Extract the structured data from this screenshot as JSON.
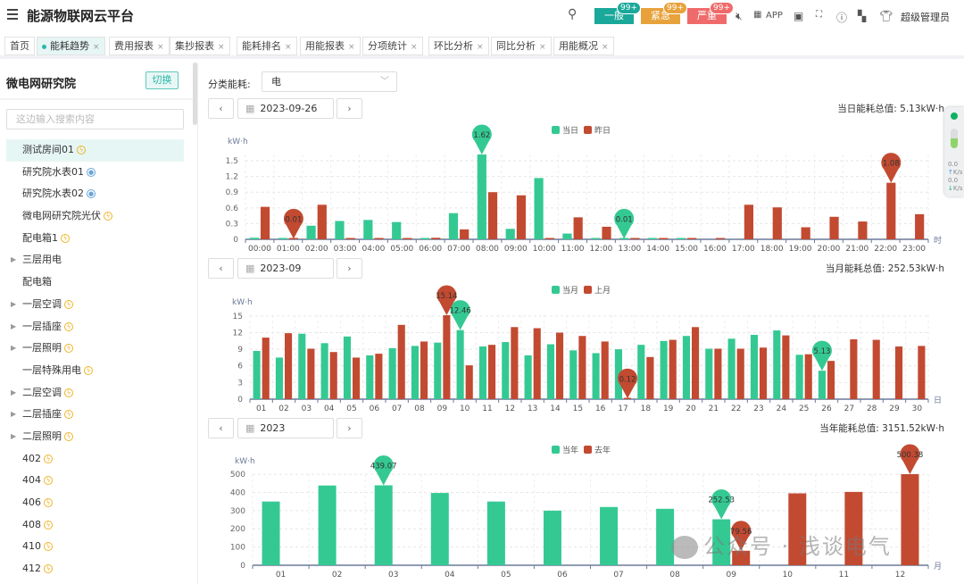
{
  "header": {
    "title": "能源物联网云平台",
    "alarms": [
      {
        "label": "一般",
        "count": "99+",
        "color": "#1aa89a"
      },
      {
        "label": "紧急",
        "count": "99+",
        "color": "#e8a23b"
      },
      {
        "label": "严重",
        "count": "99+",
        "color": "#ef6b6b"
      }
    ],
    "app_label": "APP",
    "user": "超级管理员"
  },
  "tabs": [
    {
      "label": "首页"
    },
    {
      "label": "能耗趋势",
      "active": true
    },
    {
      "label": "费用报表"
    },
    {
      "label": "集抄报表"
    },
    {
      "label": "能耗排名"
    },
    {
      "label": "用能报表"
    },
    {
      "label": "分项统计"
    },
    {
      "label": "环比分析"
    },
    {
      "label": "同比分析"
    },
    {
      "label": "用能概况"
    }
  ],
  "sidebar": {
    "title": "微电网研究院",
    "switch_label": "切换",
    "search_placeholder": "这边输入搜索内容",
    "items": [
      {
        "label": "测试房间01",
        "icon": "bolt",
        "selected": true
      },
      {
        "label": "研究院水表01",
        "icon": "drop"
      },
      {
        "label": "研究院水表02",
        "icon": "drop"
      },
      {
        "label": "微电网研究院光伏",
        "icon": "bolt"
      },
      {
        "label": "配电箱1",
        "icon": "bolt"
      },
      {
        "label": "三层用电",
        "expand": true
      },
      {
        "label": "配电箱"
      },
      {
        "label": "一层空调",
        "icon": "bolt",
        "expand": true
      },
      {
        "label": "一层插座",
        "icon": "bolt",
        "expand": true
      },
      {
        "label": "一层照明",
        "icon": "bolt",
        "expand": true
      },
      {
        "label": "一层特殊用电",
        "icon": "bolt"
      },
      {
        "label": "二层空调",
        "icon": "bolt",
        "expand": true
      },
      {
        "label": "二层插座",
        "icon": "bolt",
        "expand": true
      },
      {
        "label": "二层照明",
        "icon": "bolt",
        "expand": true
      },
      {
        "label": "402",
        "icon": "bolt"
      },
      {
        "label": "404",
        "icon": "bolt"
      },
      {
        "label": "406",
        "icon": "bolt"
      },
      {
        "label": "408",
        "icon": "bolt"
      },
      {
        "label": "410",
        "icon": "bolt"
      },
      {
        "label": "412",
        "icon": "bolt"
      }
    ]
  },
  "filter": {
    "label": "分类能耗:",
    "value": "电"
  },
  "panels": [
    {
      "date": "2023-09-26",
      "total": "当日能耗总值: 5.13kW·h"
    },
    {
      "date": "2023-09",
      "total": "当月能耗总值: 252.53kW·h"
    },
    {
      "date": "2023",
      "total": "当年能耗总值: 3151.52kW·h"
    }
  ],
  "float_panel": {
    "up": "0.0",
    "up_unit": "K/s",
    "down": "0.0",
    "down_unit": "K/s"
  },
  "watermark": "公众号 · 浅谈电气",
  "colors": {
    "current": "#34c993",
    "previous": "#c24a31"
  },
  "chart_data": [
    {
      "type": "bar",
      "ylabel": "kW·h",
      "xunit": "时",
      "ylim": [
        0,
        1.62
      ],
      "yticks": [
        0,
        0.3,
        0.6,
        0.9,
        1.2,
        1.5
      ],
      "categories": [
        "00:00",
        "01:00",
        "02:00",
        "03:00",
        "04:00",
        "05:00",
        "06:00",
        "07:00",
        "08:00",
        "09:00",
        "10:00",
        "11:00",
        "12:00",
        "13:00",
        "14:00",
        "15:00",
        "16:00",
        "17:00",
        "18:00",
        "19:00",
        "20:00",
        "21:00",
        "22:00",
        "23:00"
      ],
      "series": [
        {
          "name": "当日",
          "values": [
            0.03,
            0.01,
            0.26,
            0.35,
            0.37,
            0.33,
            0.01,
            0.5,
            1.62,
            0.2,
            1.17,
            0.11,
            0.01,
            0.01,
            0.01,
            0.01,
            0,
            0,
            0,
            0,
            0,
            0,
            0,
            0
          ],
          "markers": [
            {
              "index": 8,
              "label": "1.62"
            },
            {
              "index": 13,
              "label": "0.01"
            }
          ]
        },
        {
          "name": "昨日",
          "values": [
            0.62,
            0.01,
            0.66,
            0.02,
            0.01,
            0.01,
            0.03,
            0.19,
            0.9,
            0.84,
            0.01,
            0.42,
            0.24,
            0.01,
            0.01,
            0.01,
            0.01,
            0.66,
            0.61,
            0.23,
            0.43,
            0.34,
            1.08,
            0.48
          ],
          "markers": [
            {
              "index": 1,
              "label": "0.01"
            },
            {
              "index": 22,
              "label": "1.08"
            }
          ]
        }
      ]
    },
    {
      "type": "bar",
      "ylabel": "kW·h",
      "xunit": "日",
      "ylim": [
        0,
        15.14
      ],
      "yticks": [
        0,
        3,
        6,
        9,
        12,
        15
      ],
      "categories": [
        "01",
        "02",
        "03",
        "04",
        "05",
        "06",
        "07",
        "08",
        "09",
        "10",
        "11",
        "12",
        "13",
        "14",
        "15",
        "16",
        "17",
        "18",
        "19",
        "20",
        "21",
        "22",
        "23",
        "24",
        "25",
        "26",
        "27",
        "28",
        "29",
        "30"
      ],
      "series": [
        {
          "name": "当月",
          "values": [
            8.7,
            7.5,
            11.8,
            10.1,
            11.3,
            7.9,
            9.2,
            9.6,
            10.2,
            12.46,
            9.5,
            10.3,
            7.9,
            9.9,
            8.8,
            8.3,
            9.0,
            9.8,
            10.5,
            11.4,
            9.1,
            10.9,
            11.6,
            12.4,
            8.0,
            5.13,
            null,
            null,
            null,
            null
          ],
          "markers": [
            {
              "index": 9,
              "label": "12.46"
            },
            {
              "index": 25,
              "label": "5.13"
            }
          ]
        },
        {
          "name": "上月",
          "values": [
            11.1,
            11.9,
            9.1,
            8.5,
            7.5,
            8.2,
            13.4,
            10.4,
            15.14,
            6.1,
            9.8,
            13.0,
            12.8,
            12.0,
            11.4,
            10.4,
            0.12,
            7.6,
            10.7,
            13.0,
            9.1,
            9.1,
            9.3,
            11.5,
            8.1,
            6.9,
            10.8,
            10.7,
            9.5,
            9.6
          ],
          "markers": [
            {
              "index": 8,
              "label": "15.14"
            },
            {
              "index": 16,
              "label": "0.12"
            }
          ]
        }
      ]
    },
    {
      "type": "bar",
      "ylabel": "kW·h",
      "xunit": "月",
      "ylim": [
        0,
        500.38
      ],
      "yticks": [
        0,
        100,
        200,
        300,
        400,
        500
      ],
      "categories": [
        "01",
        "02",
        "03",
        "04",
        "05",
        "06",
        "07",
        "08",
        "09",
        "10",
        "11",
        "12"
      ],
      "series": [
        {
          "name": "当年",
          "values": [
            350,
            438,
            439.07,
            397,
            350,
            300,
            320,
            310,
            252.53,
            null,
            null,
            null
          ],
          "markers": [
            {
              "index": 2,
              "label": "439.07"
            },
            {
              "index": 8,
              "label": "252.53"
            }
          ]
        },
        {
          "name": "去年",
          "values": [
            null,
            null,
            null,
            null,
            null,
            null,
            null,
            null,
            79.56,
            395,
            403,
            500.38
          ],
          "markers": [
            {
              "index": 11,
              "label": "500.38"
            },
            {
              "index": 8,
              "label": "79.56"
            }
          ]
        }
      ]
    }
  ]
}
